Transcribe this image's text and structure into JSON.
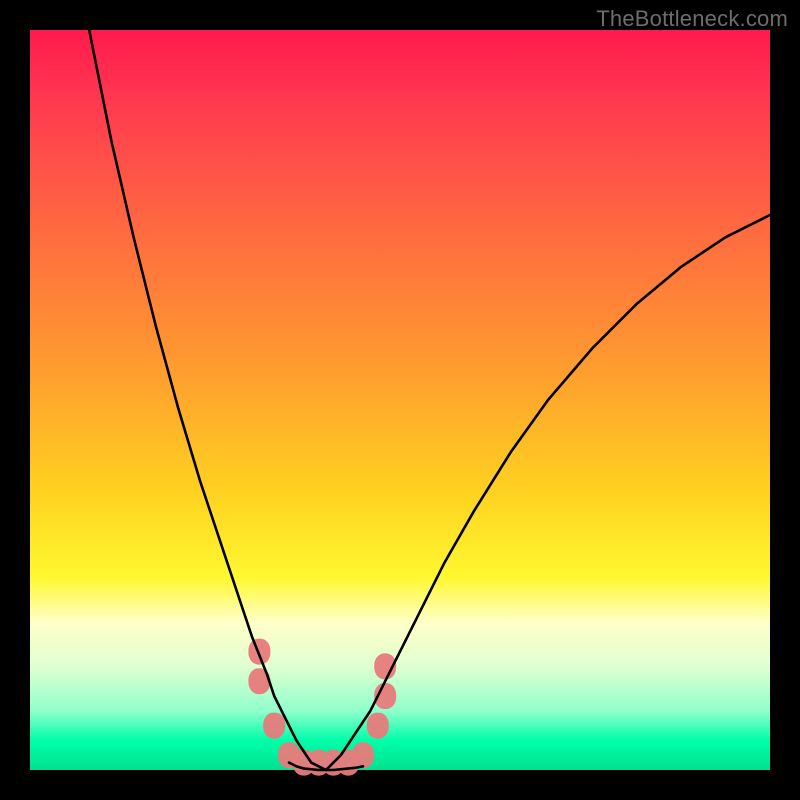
{
  "watermark": {
    "text": "TheBottleneck.com"
  },
  "chart_data": {
    "type": "line",
    "title": "",
    "xlabel": "",
    "ylabel": "",
    "xlim": [
      0,
      100
    ],
    "ylim": [
      0,
      100
    ],
    "legend": false,
    "grid": false,
    "background": {
      "type": "vertical-gradient",
      "stops": [
        {
          "pos": 0,
          "color": "#ff1a4d"
        },
        {
          "pos": 27,
          "color": "#ff6a40"
        },
        {
          "pos": 62,
          "color": "#ffd020"
        },
        {
          "pos": 80,
          "color": "#ffffc8"
        },
        {
          "pos": 96,
          "color": "#00ffaa"
        },
        {
          "pos": 100,
          "color": "#00e090"
        }
      ]
    },
    "series": [
      {
        "name": "left-curve",
        "color": "#000000",
        "x": [
          8,
          11,
          14,
          17,
          20,
          23,
          26,
          28,
          30,
          32,
          33,
          34,
          35,
          36,
          38,
          40
        ],
        "y": [
          100,
          85,
          72,
          60,
          49,
          39,
          30,
          24,
          18,
          13,
          10,
          8,
          6,
          4,
          1,
          0
        ]
      },
      {
        "name": "right-curve",
        "color": "#000000",
        "x": [
          40,
          42,
          44,
          46,
          48,
          50,
          53,
          56,
          60,
          65,
          70,
          76,
          82,
          88,
          94,
          100
        ],
        "y": [
          0,
          2,
          5,
          8,
          12,
          16,
          22,
          28,
          35,
          43,
          50,
          57,
          63,
          68,
          72,
          75
        ]
      },
      {
        "name": "bottom-flat",
        "color": "#000000",
        "x": [
          35,
          36,
          37,
          38,
          39,
          40,
          41,
          42,
          43,
          44,
          45
        ],
        "y": [
          1,
          0.5,
          0.2,
          0.1,
          0,
          0,
          0,
          0.1,
          0.2,
          0.3,
          0.5
        ]
      }
    ],
    "markers": [
      {
        "name": "marker-cluster",
        "color": "#e77b7b",
        "shape": "rounded-blob",
        "points": [
          {
            "x": 31,
            "y": 16
          },
          {
            "x": 31,
            "y": 12
          },
          {
            "x": 33,
            "y": 6
          },
          {
            "x": 35,
            "y": 2
          },
          {
            "x": 37,
            "y": 1
          },
          {
            "x": 39,
            "y": 1
          },
          {
            "x": 41,
            "y": 1
          },
          {
            "x": 43,
            "y": 1
          },
          {
            "x": 45,
            "y": 2
          },
          {
            "x": 47,
            "y": 6
          },
          {
            "x": 48,
            "y": 10
          },
          {
            "x": 48,
            "y": 14
          }
        ]
      }
    ]
  }
}
